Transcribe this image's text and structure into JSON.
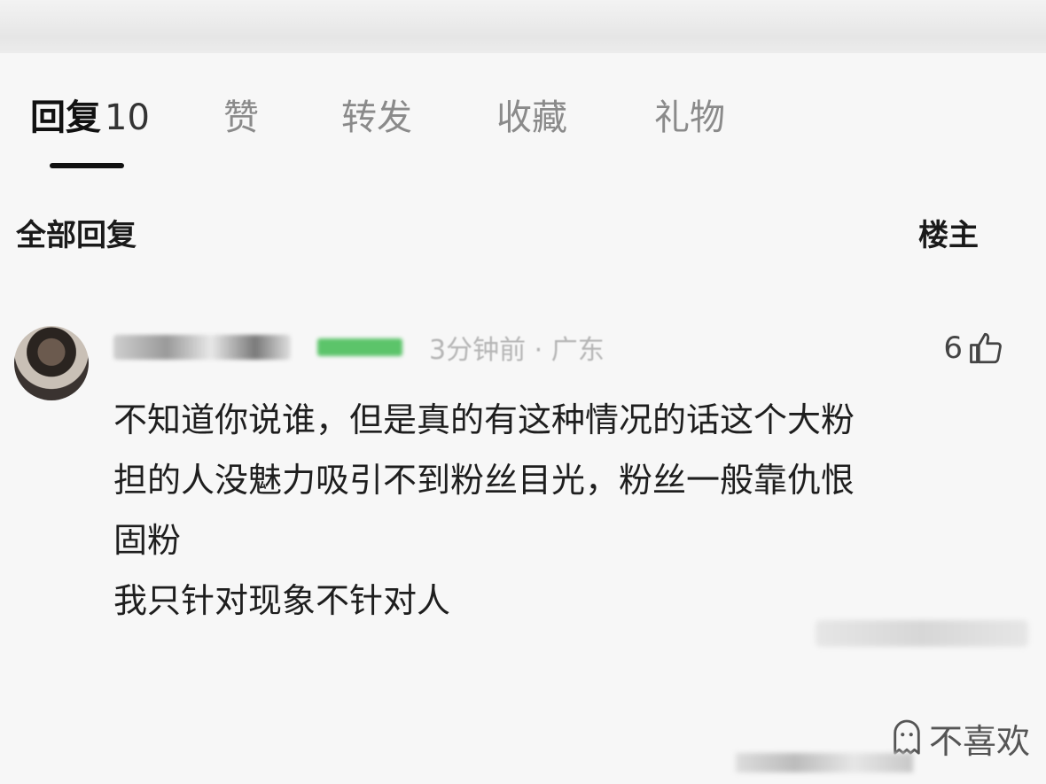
{
  "tabs": [
    {
      "label": "回复",
      "count": "10",
      "active": true
    },
    {
      "label": "赞",
      "active": false
    },
    {
      "label": "转发",
      "active": false
    },
    {
      "label": "收藏",
      "active": false
    },
    {
      "label": "礼物",
      "active": false
    }
  ],
  "filter": {
    "all_label": "全部回复",
    "owner_label": "楼主"
  },
  "comment": {
    "time_location": "3分钟前 · 广东",
    "like_count": "6",
    "body_lines": [
      "不知道你说谁，但是真的有这种情况的话这个大粉",
      "担的人没魅力吸引不到粉丝目光，粉丝一般靠仇恨",
      "固粉",
      "我只针对现象不针对人"
    ]
  },
  "dislike_label": "不喜欢",
  "icons": {
    "like": "thumbs-up-icon",
    "dislike": "dislike-face-icon"
  }
}
